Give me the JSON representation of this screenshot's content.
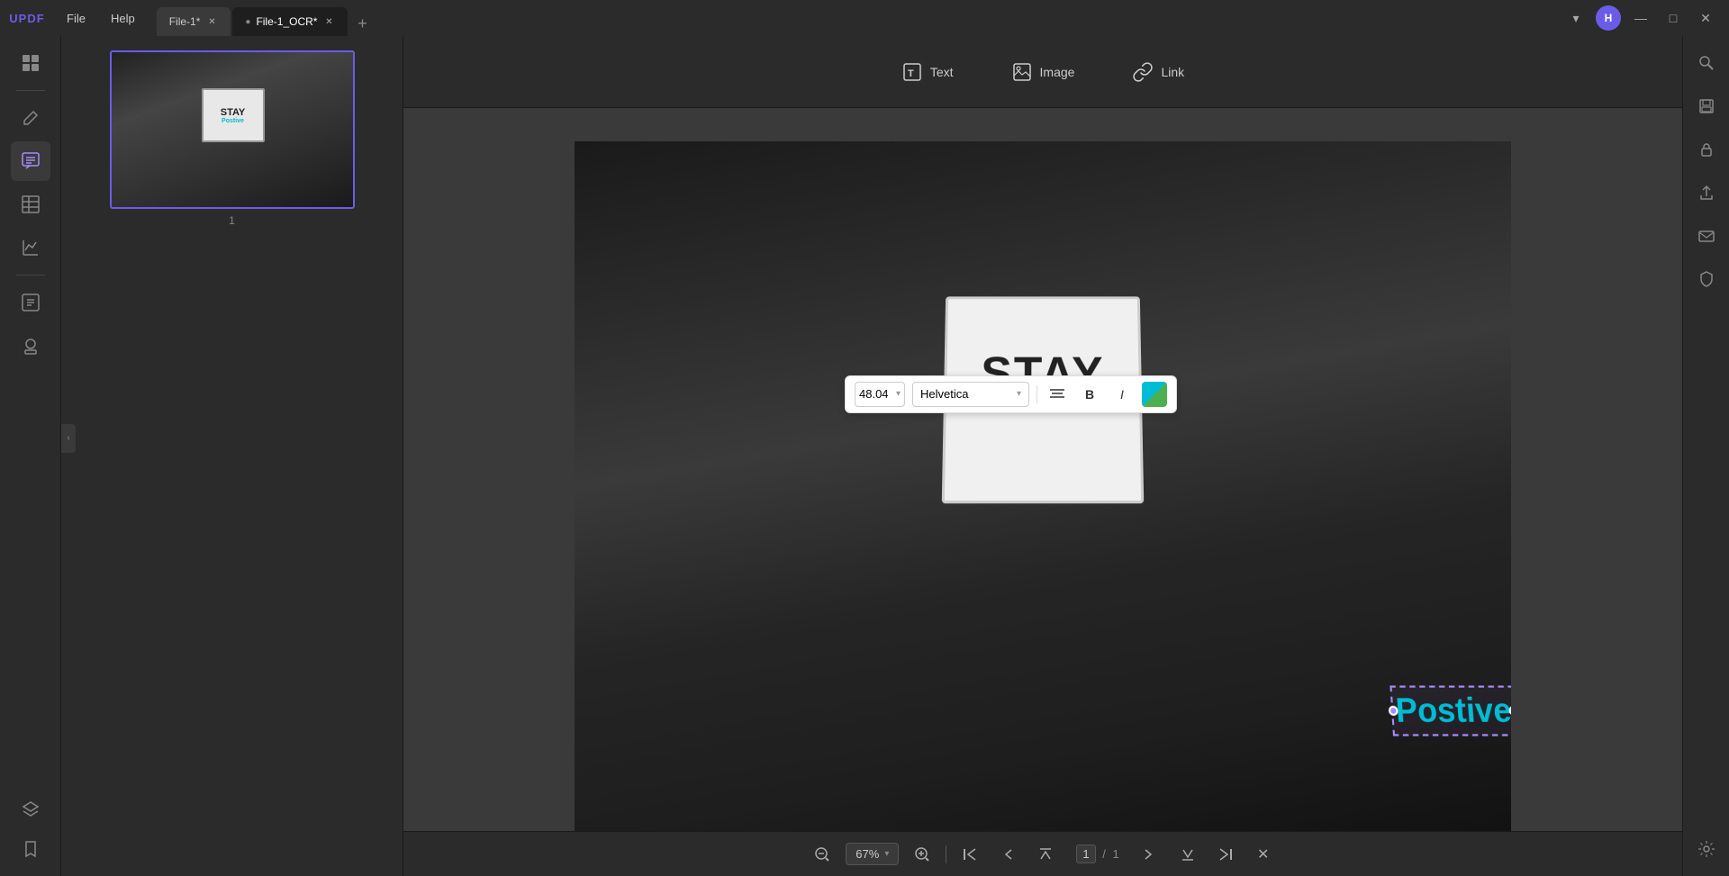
{
  "app": {
    "name": "UPDF",
    "logo": "UPDF"
  },
  "titlebar": {
    "menu": [
      "File",
      "Help"
    ],
    "tabs": [
      {
        "label": "File-1*",
        "active": false,
        "id": "tab-file1"
      },
      {
        "label": "File-1_OCR*",
        "active": true,
        "id": "tab-file1-ocr"
      }
    ],
    "new_tab_label": "+",
    "user_initial": "H",
    "minimize_icon": "—",
    "maximize_icon": "□",
    "close_icon": "✕",
    "dropdown_icon": "▾"
  },
  "toolbar": {
    "text_label": "Text",
    "image_label": "Image",
    "link_label": "Link"
  },
  "sidebar_left": {
    "icons": [
      {
        "name": "thumbnails-icon",
        "symbol": "⊞",
        "active": false
      },
      {
        "name": "edit-icon",
        "symbol": "✏",
        "active": false
      },
      {
        "name": "comment-icon",
        "symbol": "💬",
        "active": true
      },
      {
        "name": "table-icon",
        "symbol": "⊟",
        "active": false
      },
      {
        "name": "graph-icon",
        "symbol": "📊",
        "active": false
      }
    ],
    "bottom_icons": [
      {
        "name": "bookmark-icon",
        "symbol": "🔖"
      },
      {
        "name": "layers-icon",
        "symbol": "⧉"
      },
      {
        "name": "stamp-icon",
        "symbol": "⊕"
      },
      {
        "name": "attachment-icon",
        "symbol": "📎"
      }
    ]
  },
  "sidebar_right": {
    "icons": [
      {
        "name": "search-icon",
        "symbol": "🔍"
      },
      {
        "name": "save-icon",
        "symbol": "💾"
      },
      {
        "name": "lock-icon",
        "symbol": "🔒"
      },
      {
        "name": "share-icon",
        "symbol": "↑"
      },
      {
        "name": "email-icon",
        "symbol": "✉"
      },
      {
        "name": "security-icon",
        "symbol": "🛡"
      },
      {
        "name": "plugin-icon",
        "symbol": "✦"
      }
    ]
  },
  "thumbnail": {
    "page_number": "1",
    "sign_stay": "STAY",
    "sign_positive": "Postive"
  },
  "canvas": {
    "sign_stay": "STAY",
    "sign_postive": "Postive"
  },
  "format_toolbar": {
    "font_size": "48.04",
    "font_size_arrow": "▾",
    "font_name": "Helvetica",
    "font_name_arrow": "▾",
    "align_icon": "≡",
    "bold_label": "B",
    "italic_label": "I"
  },
  "bottom_bar": {
    "zoom_out_icon": "−",
    "zoom_level": "67%",
    "zoom_arrow": "▾",
    "zoom_in_icon": "+",
    "divider": "|",
    "first_page_icon": "⏮",
    "prev_page_icon": "▲",
    "page_display": "1 / 1",
    "next_page_icon": "▼",
    "last_page_icon": "⏭",
    "close_icon": "✕"
  },
  "colors": {
    "accent_purple": "#6b5ce7",
    "accent_cyan": "#00bcd4",
    "bg_dark": "#2b2b2b",
    "bg_darker": "#1e1e1e",
    "text_light": "#cccccc",
    "selection_purple": "#a78bfa"
  }
}
